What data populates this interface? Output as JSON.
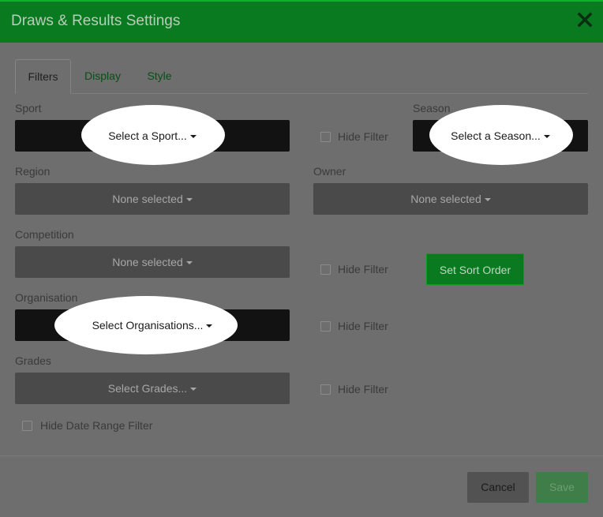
{
  "dialog": {
    "title": "Draws & Results Settings"
  },
  "tabs": [
    {
      "label": "Filters",
      "active": true
    },
    {
      "label": "Display",
      "active": false
    },
    {
      "label": "Style",
      "active": false
    }
  ],
  "filters": {
    "sport": {
      "label": "Sport",
      "value": "Select a Sport..."
    },
    "season": {
      "label": "Season",
      "value": "Select a Season..."
    },
    "region": {
      "label": "Region",
      "value": "None selected"
    },
    "owner": {
      "label": "Owner",
      "value": "None selected"
    },
    "competition": {
      "label": "Competition",
      "value": "None selected"
    },
    "organisation": {
      "label": "Organisation",
      "value": "Select Organisations..."
    },
    "grades": {
      "label": "Grades",
      "value": "Select Grades..."
    },
    "hide_filter_label": "Hide Filter",
    "hide_date_range_label": "Hide Date Range Filter"
  },
  "buttons": {
    "set_sort_order": "Set Sort Order",
    "cancel": "Cancel",
    "save": "Save"
  },
  "colors": {
    "header": "#097a1f",
    "accent": "#0fb02f",
    "dropdown": "#4a4a4a",
    "dropdown_highlight": "#121212"
  }
}
